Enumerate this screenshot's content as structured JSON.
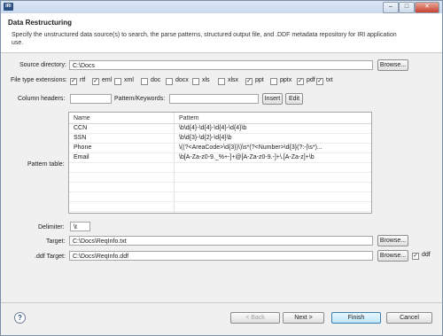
{
  "window": {
    "app_icon_text": "IRI",
    "minimize": "–",
    "maximize": "□",
    "close": "✕"
  },
  "header": {
    "title": "Data Restructuring",
    "description": "Specify the unstructured data source(s) to search, the parse patterns, structured output file, and .DDF metadata repository for IRI application use."
  },
  "source": {
    "label": "Source directory:",
    "value": "C:\\Docs",
    "browse": "Browse..."
  },
  "file_types": {
    "label": "File type extensions:",
    "items": [
      {
        "name": "rtf",
        "checked": true
      },
      {
        "name": "eml",
        "checked": true
      },
      {
        "name": "xml",
        "checked": false
      },
      {
        "name": "doc",
        "checked": false
      },
      {
        "name": "docx",
        "checked": false
      },
      {
        "name": "xls",
        "checked": false
      },
      {
        "name": "xlsx",
        "checked": false
      },
      {
        "name": "ppt",
        "checked": true
      },
      {
        "name": "pptx",
        "checked": false
      },
      {
        "name": "pdf",
        "checked": true
      },
      {
        "name": "txt",
        "checked": true
      }
    ]
  },
  "column_headers": {
    "label": "Column headers:",
    "value": "",
    "pattern_label": "Pattern/Keywords:",
    "pattern_value": "",
    "insert": "Insert",
    "edit": "Edit"
  },
  "pattern_table": {
    "label": "Pattern table:",
    "columns": [
      "Name",
      "Pattern"
    ],
    "rows": [
      {
        "name": "CCN",
        "pattern": "\\b\\d{4}-\\d{4}-\\d{4}-\\d{4}\\b"
      },
      {
        "name": "SSN",
        "pattern": "\\b\\d{3}-\\d{2}-\\d{4}\\b"
      },
      {
        "name": "Phone",
        "pattern": "\\((?<AreaCode>\\d{3})\\)\\s*(?<Number>\\d{3}(?:-|\\s*)..."
      },
      {
        "name": "Email",
        "pattern": "\\b[A-Za-z0-9._%+-]+@[A-Za-z0-9.-]+\\.[A-Za-z]+\\b"
      }
    ]
  },
  "delimiter": {
    "label": "Delimiter:",
    "value": "\\t"
  },
  "target": {
    "label": "Target:",
    "value": "C:\\Docs\\ReqInfo.txt",
    "browse": "Browse..."
  },
  "ddf_target": {
    "label": ".ddf Target:",
    "value": "C:\\Docs\\ReqInfo.ddf",
    "browse": "Browse...",
    "ddf_checkbox_label": "ddf",
    "ddf_checked": true
  },
  "footer": {
    "help": "?",
    "back": "< Back",
    "next": "Next >",
    "finish": "Finish",
    "cancel": "Cancel"
  }
}
